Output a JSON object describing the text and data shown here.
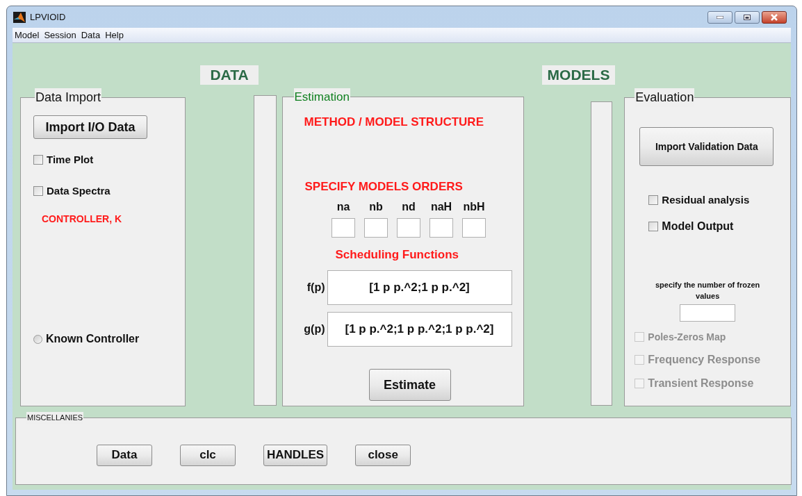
{
  "window": {
    "title": "LPVIOID"
  },
  "menu": [
    "Model",
    "Session",
    "Data",
    "Help"
  ],
  "headers": [
    "DATA",
    "MODELS"
  ],
  "data_import": {
    "title": "Data Import",
    "import_button": "Import  I/O Data",
    "checkboxes": [
      {
        "label": "Time Plot",
        "checked": false
      },
      {
        "label": "Data Spectra",
        "checked": false
      }
    ],
    "controller_label": "CONTROLLER, K",
    "known_controller": {
      "label": "Known Controller",
      "selected": false
    }
  },
  "estimation": {
    "title": "Estimation",
    "method_heading": "METHOD / MODEL STRUCTURE",
    "orders_heading": "SPECIFY  MODELS ORDERS",
    "orders": [
      "na",
      "nb",
      "nd",
      "naH",
      "nbH"
    ],
    "scheduling_heading": "Scheduling Functions",
    "functions": [
      {
        "label": "f(p)",
        "value": "[1 p p.^2;1 p p.^2]"
      },
      {
        "label": "g(p)",
        "value": "[1 p p.^2;1 p p.^2;1 p p.^2]"
      }
    ],
    "estimate_button": "Estimate"
  },
  "evaluation": {
    "title": "Evaluation",
    "validation_button": "Import Validation Data",
    "checkboxes": [
      {
        "label": "Residual analysis",
        "checked": false,
        "disabled": false
      },
      {
        "label": "Model Output",
        "checked": false,
        "disabled": false
      }
    ],
    "frozen_label": "specify the number of frozen values",
    "plots": [
      {
        "label": "Poles-Zeros Map",
        "checked": false,
        "disabled": true
      },
      {
        "label": "Frequency Response",
        "checked": false,
        "disabled": true
      },
      {
        "label": "Transient Response",
        "checked": false,
        "disabled": true
      }
    ]
  },
  "miscellanies": {
    "title": "MISCELLANIES",
    "buttons": [
      "Data",
      "clc",
      "HANDLES",
      "close"
    ]
  }
}
